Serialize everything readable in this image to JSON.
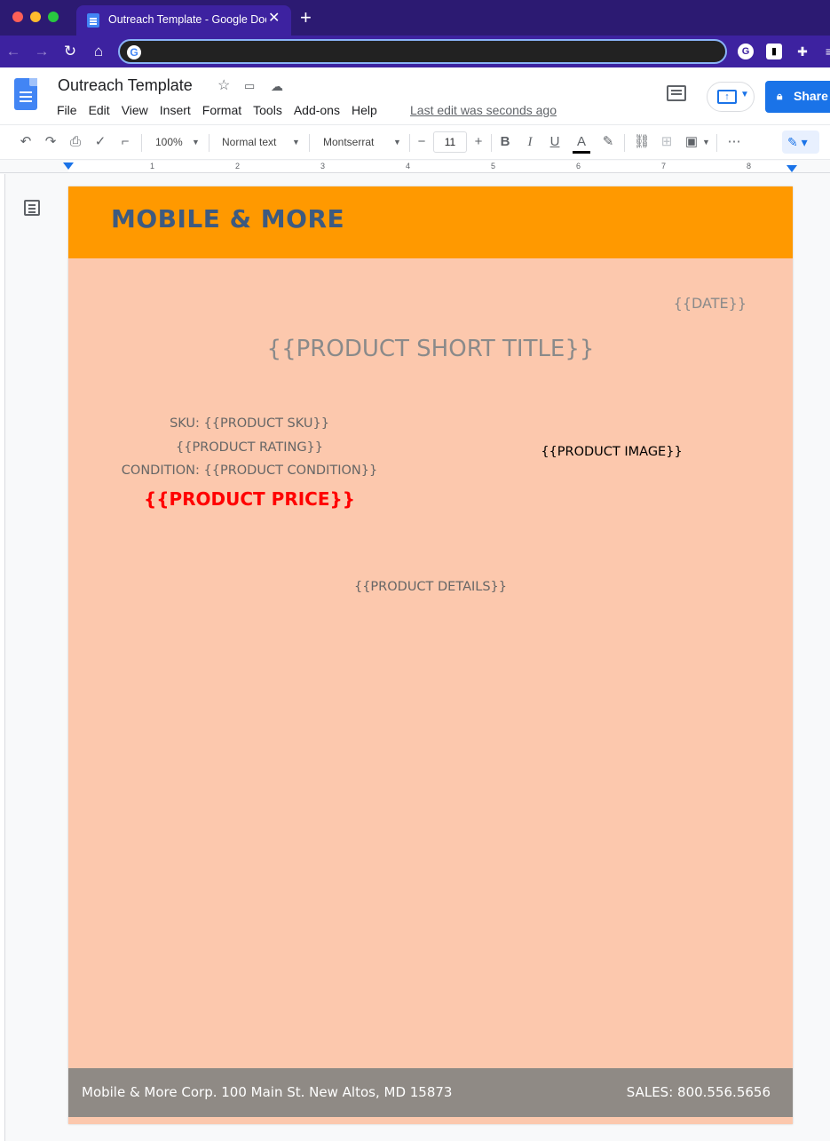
{
  "browser": {
    "tab_title": "Outreach Template - Google Docs",
    "tab_close": "✕",
    "new_tab": "+",
    "back": "←",
    "forward": "→",
    "reload": "↻",
    "home": "⌂",
    "omnibox_value": "",
    "omnibox_icon": "G"
  },
  "docs": {
    "title": "Outreach Template",
    "menu": [
      "File",
      "Edit",
      "View",
      "Insert",
      "Format",
      "Tools",
      "Add-ons",
      "Help"
    ],
    "last_edit": "Last edit was seconds ago",
    "share_label": "Share",
    "present_glyph": "↑"
  },
  "toolbar": {
    "zoom": "100%",
    "style": "Normal text",
    "font": "Montserrat",
    "font_size": "11",
    "minus": "−",
    "plus": "+",
    "bold": "B",
    "italic": "I",
    "underline": "U",
    "text_color": "A",
    "more": "⋯"
  },
  "ruler": {
    "marks": [
      "1",
      "2",
      "3",
      "4",
      "5",
      "6",
      "7",
      "8"
    ]
  },
  "document": {
    "brand": "MOBILE & MORE",
    "date": "{{DATE}}",
    "short_title": "{{PRODUCT SHORT TITLE}}",
    "sku": "SKU: {{PRODUCT SKU}}",
    "rating": "{{PRODUCT RATING}}",
    "condition": "CONDITION: {{PRODUCT CONDITION}}",
    "price": "{{PRODUCT PRICE}}",
    "image": "{{PRODUCT IMAGE}}",
    "details": "{{PRODUCT DETAILS}}",
    "footer_address": "Mobile & More Corp. 100 Main St. New Altos, MD 15873",
    "footer_sales": "SALES: 800.556.5656"
  },
  "colors": {
    "tabbar": "#2c1a72",
    "header_orange": "#ff9900",
    "page_peach": "#fcc8ad",
    "brand_blue": "#3d5a80",
    "price_red": "#ff0000",
    "footer_gray": "#8f8a85",
    "share_blue": "#1a73e8"
  },
  "icons": {
    "traffic": [
      "close-light",
      "minimize-light",
      "zoom-light"
    ],
    "title_actions": [
      "star-icon",
      "move-to-folder-icon",
      "cloud-saved-icon"
    ],
    "toolbar": [
      "undo-icon",
      "redo-icon",
      "print-icon",
      "spellcheck-icon",
      "paint-format-icon",
      "link-icon",
      "add-comment-icon",
      "insert-image-icon",
      "highlighter-icon",
      "more-icon",
      "edit-mode-icon"
    ]
  }
}
